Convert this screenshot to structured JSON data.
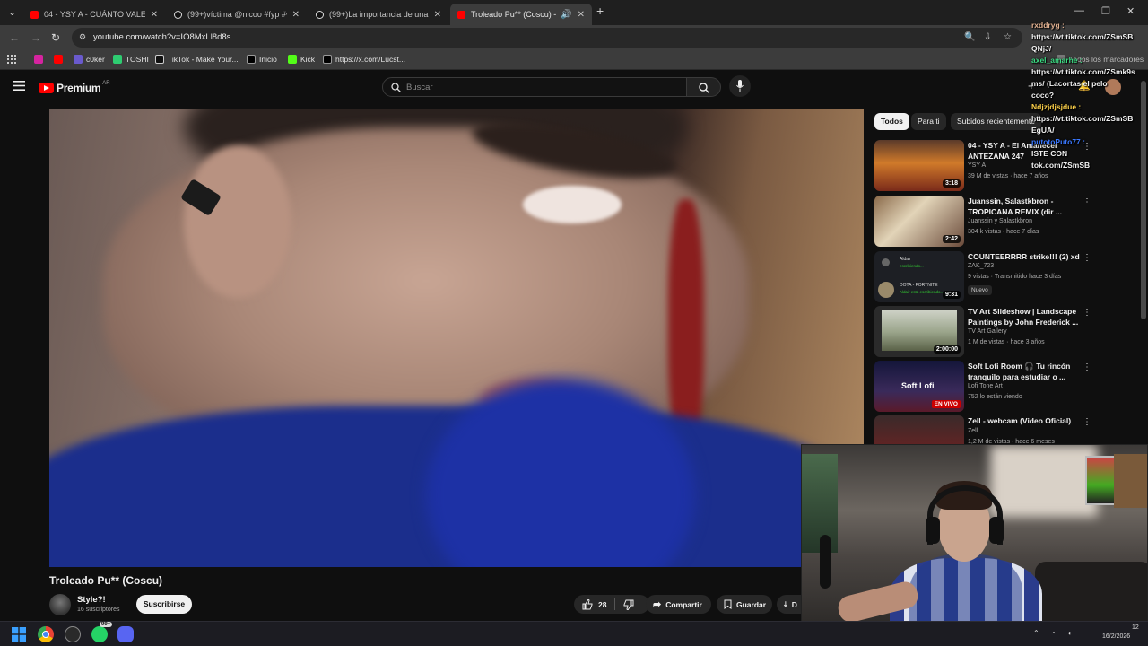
{
  "browser": {
    "tabs": [
      {
        "title": "04 - YSY A - CUÁNTO VALE HA",
        "favicon": "youtube-icon",
        "active": false
      },
      {
        "title": "(99+)víctima @nicoo #fyp #vir",
        "favicon": "tiktok-icon",
        "active": false
      },
      {
        "title": "(99+)La importancia de una fot",
        "favicon": "tiktok-icon",
        "active": false
      },
      {
        "title": "Troleado Pu** (Coscu) - You",
        "favicon": "youtube-icon",
        "active": true
      }
    ],
    "new_tab": "+",
    "url": "youtube.com/watch?v=IO8MxLl8d8s",
    "bookmarks": [
      {
        "label": "",
        "icon": "instagram-icon",
        "color": "#d6249f"
      },
      {
        "label": "",
        "icon": "youtube-icon",
        "color": "#ff0000"
      },
      {
        "label": "c0ker",
        "icon": "bookmark-icon",
        "color": "#6a5acd"
      },
      {
        "label": "TOSHI",
        "icon": "bookmark-icon",
        "color": "#2ecc71"
      },
      {
        "label": "TikTok - Make Your...",
        "icon": "tiktok-icon",
        "color": "#111111"
      },
      {
        "label": "Inicio",
        "icon": "x-icon",
        "color": "#000000"
      },
      {
        "label": "Kick",
        "icon": "kick-icon",
        "color": "#53fc18"
      },
      {
        "label": "https://x.com/Lucst...",
        "icon": "x-icon",
        "color": "#000000"
      }
    ],
    "all_bookmarks": "Todos los marcadores"
  },
  "youtube": {
    "logo_word": "Premium",
    "country": "AR",
    "search_placeholder": "Buscar",
    "chips": [
      "Todos",
      "Para ti",
      "Subidos recientemente"
    ],
    "video": {
      "title": "Troleado Pu** (Coscu)",
      "channel": "Style?!",
      "subscribers": "16 suscriptores",
      "subscribe_label": "Suscribirse",
      "likes": "28",
      "share_label": "Compartir",
      "save_label": "Guardar",
      "download_label": "D"
    },
    "recommendations": [
      {
        "title": "04 - YSY A - El Amanecer ANTEZANA 247",
        "channel": "YSY A",
        "meta": "39 M de vistas · hace 7 años",
        "duration": "3:18"
      },
      {
        "title": "Juanssin, Salastkbron - TROPICANA REMIX (dir ...",
        "channel": "Juanssin y Salastkbron",
        "meta": "304 k vistas · hace 7 días",
        "duration": "2:42"
      },
      {
        "title": "COUNTEERRRR strike!!! (2) xd",
        "channel": "ZAK_723",
        "meta": "9 vistas · Transmitido hace 3 días",
        "duration": "9:31",
        "badge": "Nuevo",
        "thumb_lines": [
          "Aldair",
          "escribiendo...",
          "DOTA - FORTNITE",
          "Aldair está escribiendo..."
        ]
      },
      {
        "title": "TV Art Slideshow | Landscape Paintings by John Frederick ...",
        "channel": "TV Art Gallery",
        "meta": "1 M de vistas · hace 3 años",
        "duration": "2:00:00"
      },
      {
        "title": "Soft Lofi Room 🎧 Tu rincón tranquilo para estudiar o ...",
        "channel": "Lofi Tone Art",
        "meta": "752 lo están viendo",
        "live": "EN VIVO",
        "thumb_text": "Soft Lofi"
      },
      {
        "title": "Zell - webcam (Video Oficial)",
        "channel": "Zell",
        "meta": "1,2 M de vistas · hace 6 meses"
      }
    ]
  },
  "chat": [
    {
      "text": "rxddryg :",
      "color": "#e0b090"
    },
    {
      "text": "https://vt.tiktok.com/ZSmSB",
      "color": "#ffffff"
    },
    {
      "text": "QNjJ/",
      "color": "#ffffff"
    },
    {
      "text": "axel_amarhe :",
      "color": "#3ddc84"
    },
    {
      "text": "https://vt.tiktok.com/ZSmk9s",
      "color": "#ffffff"
    },
    {
      "text": "ms/ (Lacortas el pelo",
      "color": "#ffffff"
    },
    {
      "text": "coco?",
      "color": "#ffffff"
    },
    {
      "text": "Ndjzjdjsjdue :",
      "color": "#ffd24a"
    },
    {
      "text": "https://vt.tiktok.com/ZSmSB",
      "color": "#ffffff"
    },
    {
      "text": "EgUA/",
      "color": "#ffffff"
    },
    {
      "text": "putotoPuto77 :",
      "color": "#3a78ff"
    },
    {
      "text": "ISTE CON",
      "color": "#ffffff"
    },
    {
      "text": "tok.com/ZSmSB",
      "color": "#ffffff"
    }
  ],
  "taskbar": {
    "time": "12",
    "date": "16/2/2026",
    "badge_count": "99+"
  }
}
